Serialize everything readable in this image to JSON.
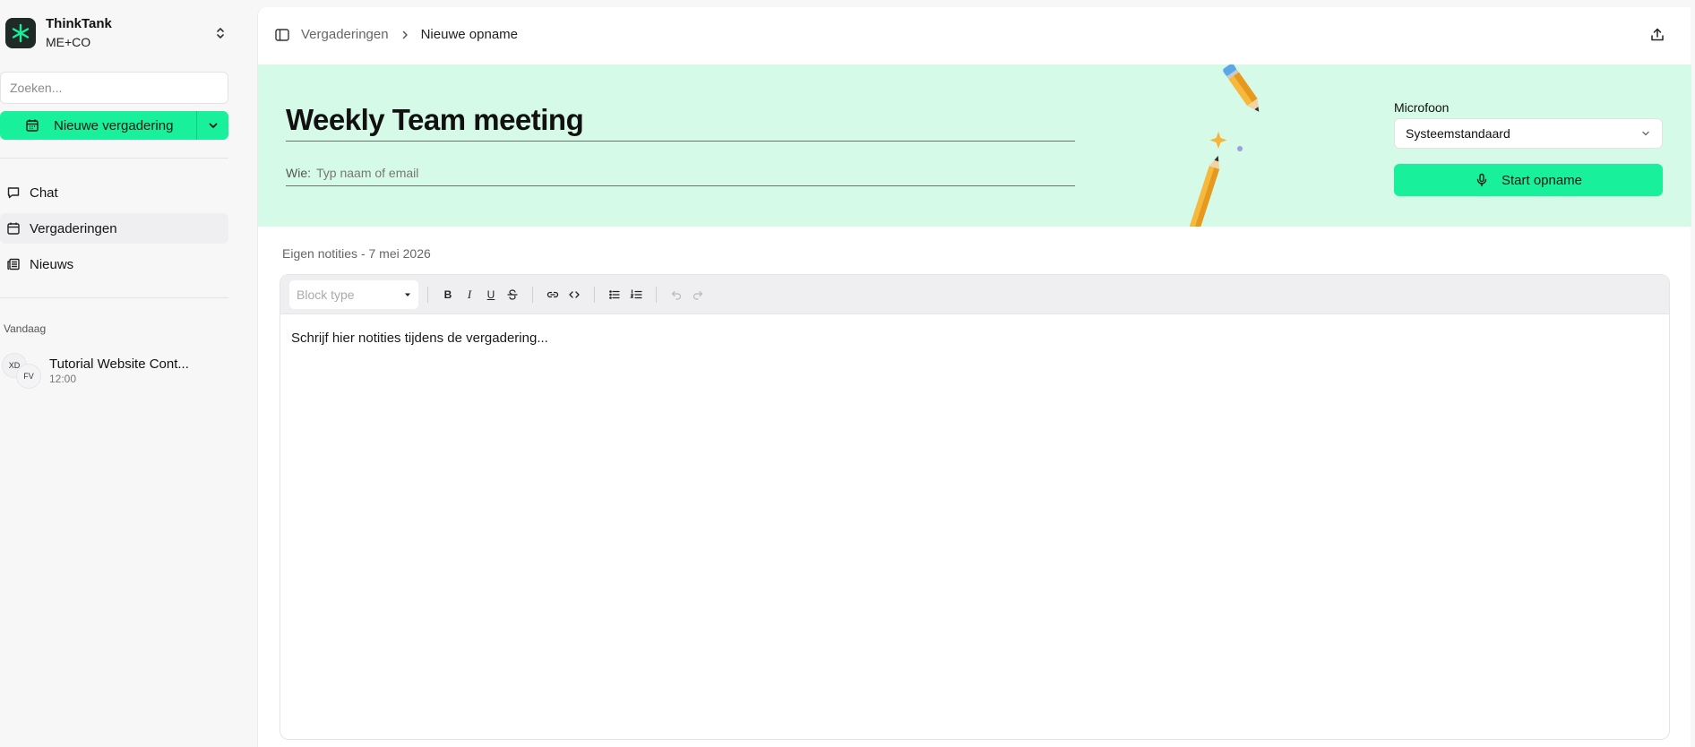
{
  "brand": {
    "name": "ThinkTank",
    "org": "ME+CO"
  },
  "search": {
    "placeholder": "Zoeken..."
  },
  "new_meeting": {
    "label": "Nieuwe vergadering"
  },
  "nav": [
    {
      "label": "Chat",
      "icon": "chat-icon"
    },
    {
      "label": "Vergaderingen",
      "icon": "calendar-icon",
      "active": true
    },
    {
      "label": "Nieuws",
      "icon": "newspaper-icon"
    }
  ],
  "recent": {
    "section": "Vandaag",
    "items": [
      {
        "title": "Tutorial Website Cont...",
        "time": "12:00",
        "avatars": [
          "XD",
          "FV"
        ]
      }
    ]
  },
  "breadcrumb": {
    "parent": "Vergaderingen",
    "current": "Nieuwe opname"
  },
  "meeting": {
    "title": "Weekly Team meeting",
    "who_label": "Wie:",
    "who_placeholder": "Typ naam of email"
  },
  "microphone": {
    "label": "Microfoon",
    "selected": "Systeemstandaard"
  },
  "start_button": {
    "label": "Start opname"
  },
  "notes": {
    "label": "Eigen notities - 7 mei 2026",
    "block_type_placeholder": "Block type",
    "toolbar": {
      "bold": "B",
      "italic": "I",
      "underline": "U"
    },
    "placeholder": "Schrijf hier notities tijdens de vergadering..."
  },
  "colors": {
    "accent": "#19f09b",
    "hero_bg": "#d6fae8",
    "sidebar_bg": "#f7f7f8"
  }
}
